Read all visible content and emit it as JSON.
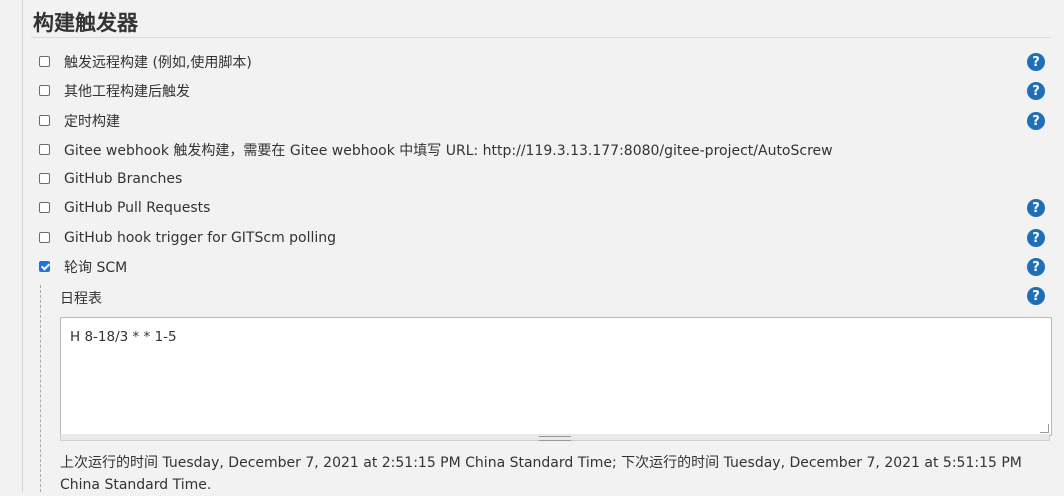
{
  "section": {
    "title": "构建触发器"
  },
  "triggers": [
    {
      "label": "触发远程构建 (例如,使用脚本)",
      "checked": false,
      "help": true
    },
    {
      "label": "其他工程构建后触发",
      "checked": false,
      "help": true
    },
    {
      "label": "定时构建",
      "checked": false,
      "help": true
    },
    {
      "label": "Gitee webhook 触发构建，需要在 Gitee webhook 中填写 URL: http://119.3.13.177:8080/gitee-project/AutoScrew",
      "checked": false,
      "help": false
    },
    {
      "label": "GitHub Branches",
      "checked": false,
      "help": false
    },
    {
      "label": "GitHub Pull Requests",
      "checked": false,
      "help": true
    },
    {
      "label": "GitHub hook trigger for GITScm polling",
      "checked": false,
      "help": true
    },
    {
      "label": "轮询 SCM",
      "checked": true,
      "help": true
    }
  ],
  "help_glyph": "?",
  "schedule": {
    "label": "日程表",
    "value": "H 8-18/3 * * 1-5",
    "run_info": "上次运行的时间 Tuesday, December 7, 2021 at 2:51:15 PM China Standard Time; 下次运行的时间 Tuesday, December 7, 2021 at 5:51:15 PM China Standard Time."
  },
  "colors": {
    "accent": "#1a73e8",
    "help_icon": "#1e6fb7",
    "background": "#f2f2f2"
  }
}
